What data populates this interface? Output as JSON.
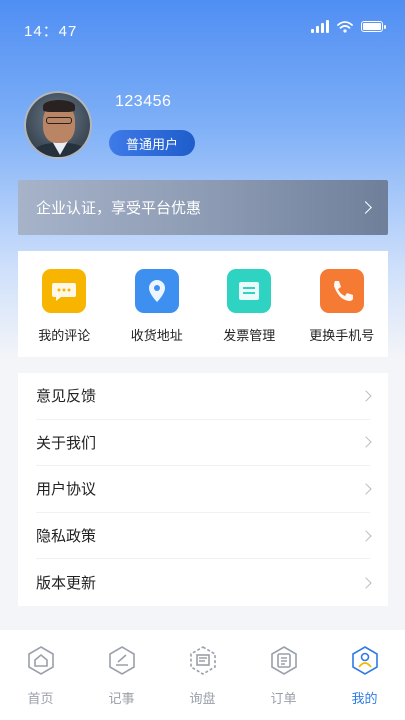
{
  "status_bar": {
    "time": "14：47"
  },
  "profile": {
    "username": "123456",
    "badge": "普通用户"
  },
  "banner": {
    "text": "企业认证，享受平台优惠"
  },
  "quick_actions": [
    {
      "label": "我的评论",
      "icon": "comment-icon",
      "color": "#f8b500"
    },
    {
      "label": "收货地址",
      "icon": "location-icon",
      "color": "#3d8ff0"
    },
    {
      "label": "发票管理",
      "icon": "invoice-icon",
      "color": "#2fd3c1"
    },
    {
      "label": "更换手机号",
      "icon": "phone-icon",
      "color": "#f57a34"
    }
  ],
  "menu": [
    {
      "label": "意见反馈"
    },
    {
      "label": "关于我们"
    },
    {
      "label": "用户协议"
    },
    {
      "label": "隐私政策"
    },
    {
      "label": "版本更新"
    }
  ],
  "tabbar": [
    {
      "label": "首页",
      "icon": "home-icon",
      "active": false
    },
    {
      "label": "记事",
      "icon": "note-icon",
      "active": false
    },
    {
      "label": "询盘",
      "icon": "inquiry-icon",
      "active": false
    },
    {
      "label": "订单",
      "icon": "order-icon",
      "active": false
    },
    {
      "label": "我的",
      "icon": "profile-icon",
      "active": true
    }
  ],
  "colors": {
    "accent": "#2f7be5",
    "banner": "#8b99b2"
  }
}
